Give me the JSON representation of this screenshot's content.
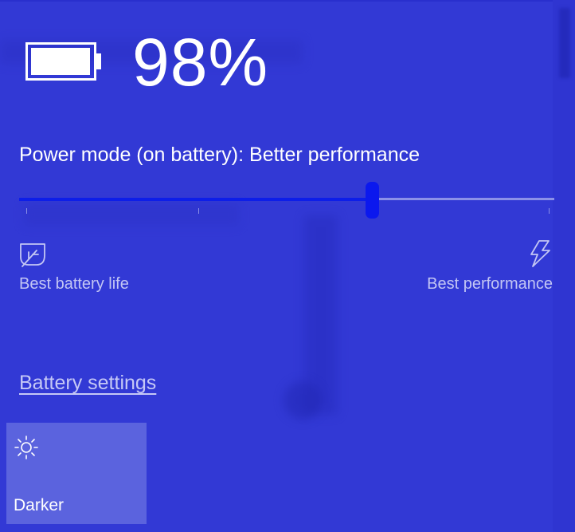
{
  "battery": {
    "percent_text": "98%",
    "charge_fraction": 0.98,
    "icon": "battery-icon"
  },
  "power_mode": {
    "label": "Power mode (on battery): Better performance",
    "slider_position_fraction": 0.66,
    "left_label": "Best battery life",
    "right_label": "Best performance",
    "left_icon": "leaf-icon",
    "right_icon": "lightning-bolt-icon"
  },
  "links": {
    "battery_settings": "Battery settings"
  },
  "quick_action": {
    "label": "Darker",
    "icon": "sun-icon"
  },
  "colors": {
    "background": "#3239d5",
    "slider_accent": "#0b18ee",
    "tile": "#5b63de"
  }
}
